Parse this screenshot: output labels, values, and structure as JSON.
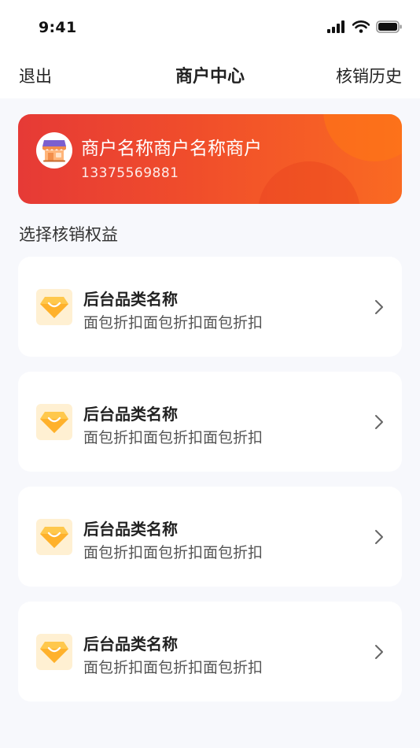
{
  "status_bar": {
    "time": "9:41"
  },
  "navbar": {
    "left_label": "退出",
    "title": "商户中心",
    "right_label": "核销历史"
  },
  "merchant": {
    "name": "商户名称商户名称商户",
    "phone": "13375569881",
    "icon": "store-icon"
  },
  "section": {
    "title": "选择核销权益"
  },
  "benefits": [
    {
      "name": "后台品类名称",
      "desc": "面包折扣面包折扣面包折扣",
      "icon": "diamond-icon"
    },
    {
      "name": "后台品类名称",
      "desc": "面包折扣面包折扣面包折扣",
      "icon": "diamond-icon"
    },
    {
      "name": "后台品类名称",
      "desc": "面包折扣面包折扣面包折扣",
      "icon": "diamond-icon"
    },
    {
      "name": "后台品类名称",
      "desc": "面包折扣面包折扣面包折扣",
      "icon": "diamond-icon"
    }
  ],
  "colors": {
    "accent_start": "#E63A36",
    "accent_end": "#FA6A22",
    "background": "#F7F8FC"
  }
}
